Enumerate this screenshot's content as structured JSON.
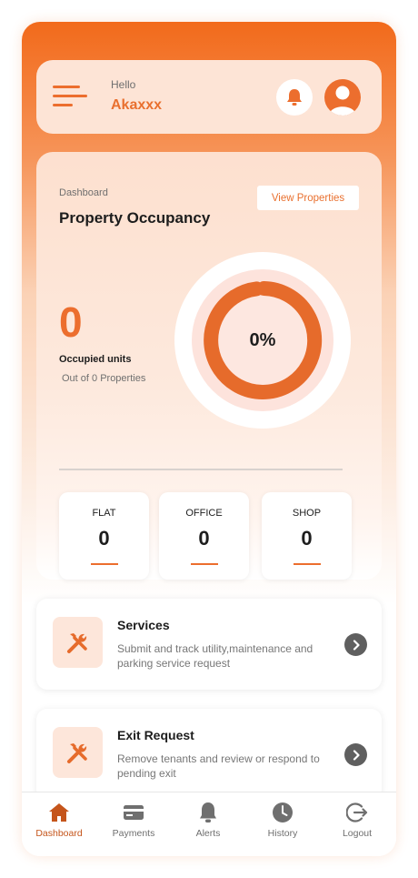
{
  "header": {
    "greeting": "Hello",
    "username": "Akaxxx"
  },
  "dashboard": {
    "label": "Dashboard",
    "title": "Property Occupancy",
    "view_properties_label": "View Properties",
    "occupied_count": "0",
    "occupied_label": "Occupied units",
    "out_of_text": "Out of 0 Properties",
    "occupancy_percent_text": "0%",
    "occupancy_percent": 0
  },
  "categories": [
    {
      "label": "FLAT",
      "value": "0"
    },
    {
      "label": "OFFICE",
      "value": "0"
    },
    {
      "label": "SHOP",
      "value": "0"
    }
  ],
  "services": [
    {
      "title": "Services",
      "description": "Submit and track utility,maintenance and parking service request"
    },
    {
      "title": "Exit Request",
      "description": "Remove tenants and review or respond to pending exit"
    }
  ],
  "nav": [
    {
      "label": "Dashboard",
      "icon": "home-icon",
      "active": true
    },
    {
      "label": "Payments",
      "icon": "card-icon",
      "active": false
    },
    {
      "label": "Alerts",
      "icon": "bell-icon",
      "active": false
    },
    {
      "label": "History",
      "icon": "clock-icon",
      "active": false
    },
    {
      "label": "Logout",
      "icon": "logout-icon",
      "active": false
    }
  ],
  "colors": {
    "accent": "#ec6e2e",
    "header_gradient_top": "#f26a1b",
    "nav_active": "#c5551b",
    "nav_inactive": "#6f6f6f"
  }
}
